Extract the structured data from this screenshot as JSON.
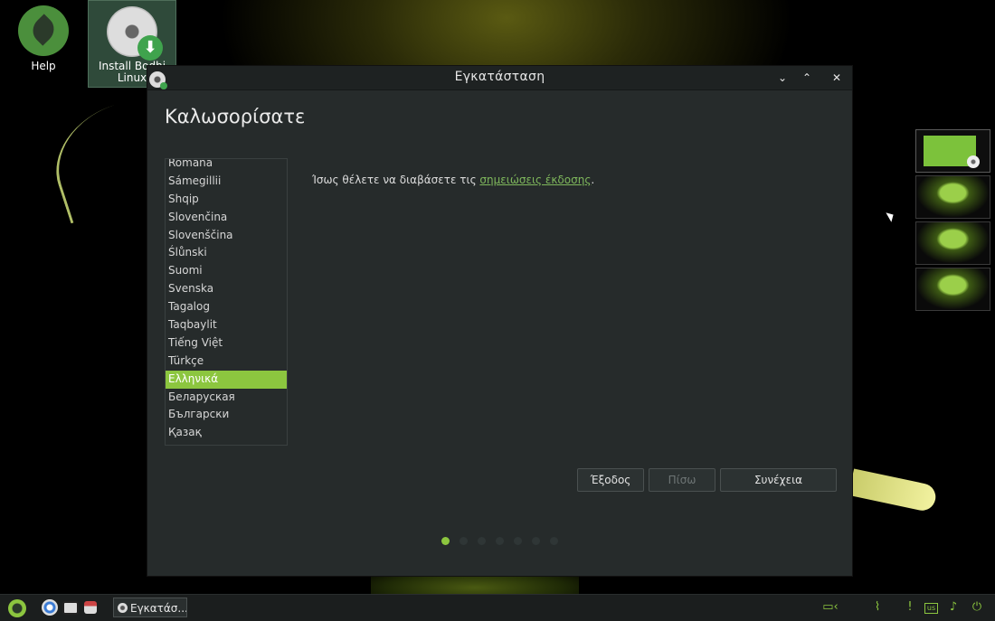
{
  "desktop": {
    "icons": [
      {
        "label": "Help"
      },
      {
        "label": "Install Bodhi Linux"
      }
    ]
  },
  "window": {
    "title": "Εγκατάσταση",
    "heading": "Καλωσορίσατε",
    "languages": [
      "Română",
      "Sámegillii",
      "Shqip",
      "Slovenčina",
      "Slovenščina",
      "Ślůnski",
      "Suomi",
      "Svenska",
      "Tagalog",
      "Taqbaylit",
      "Tiếng Việt",
      "Türkçe",
      "Ελληνικά",
      "Беларуская",
      "Български",
      "Қазақ"
    ],
    "selected_language": "Ελληνικά",
    "release_notes_prefix": "Ίσως θέλετε να διαβάσετε τις ",
    "release_notes_link": "σημειώσεις έκδοσης",
    "release_notes_suffix": ".",
    "buttons": {
      "quit": "Έξοδος",
      "back": "Πίσω",
      "continue": "Συνέχεια"
    },
    "progress": {
      "total_steps": 7,
      "current_step": 1
    },
    "controls": {
      "minimize": "⌄",
      "maximize": "⌃",
      "close": "✕"
    }
  },
  "taskbar": {
    "task_label": "Εγκατάσ...",
    "keyboard_layout": "us"
  },
  "colors": {
    "accent": "#8cc63f",
    "window_bg": "#262b2b",
    "link": "#7fb85c"
  }
}
